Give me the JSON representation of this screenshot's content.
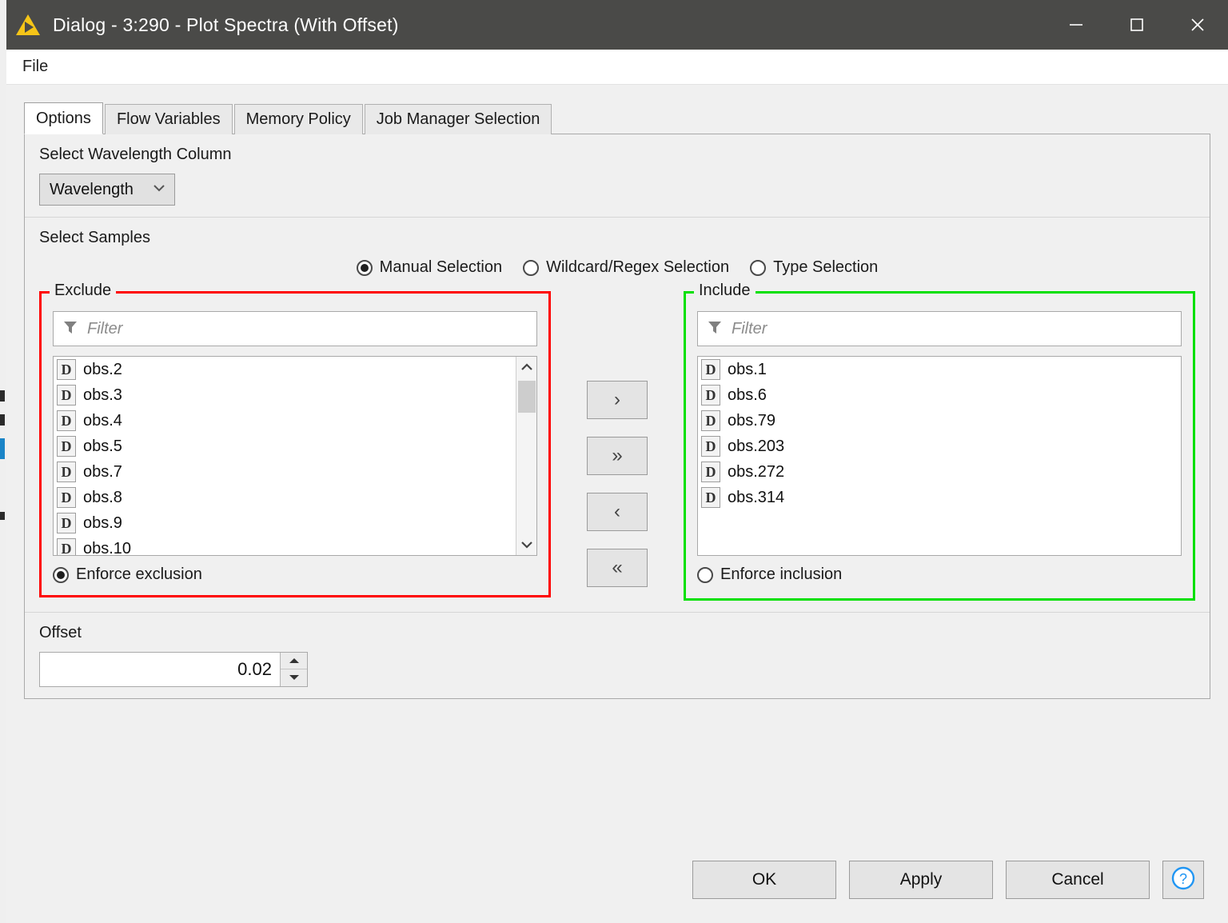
{
  "window": {
    "title": "Dialog - 3:290 - Plot Spectra (With Offset)",
    "app_icon": "knime-triangle-icon",
    "controls": {
      "minimize": "minimize-icon",
      "maximize": "maximize-icon",
      "close": "close-icon"
    }
  },
  "menubar": {
    "items": [
      "File"
    ]
  },
  "tabs": [
    {
      "label": "Options",
      "active": true
    },
    {
      "label": "Flow Variables",
      "active": false
    },
    {
      "label": "Memory Policy",
      "active": false
    },
    {
      "label": "Job Manager Selection",
      "active": false
    }
  ],
  "wavelength_section": {
    "label": "Select Wavelength Column",
    "dropdown": {
      "value": "Wavelength",
      "arrow": "chevron-down-icon"
    }
  },
  "samples_section": {
    "label": "Select Samples",
    "selection_modes": [
      {
        "label": "Manual Selection",
        "checked": true
      },
      {
        "label": "Wildcard/Regex Selection",
        "checked": false
      },
      {
        "label": "Type Selection",
        "checked": false
      }
    ],
    "exclude": {
      "legend": "Exclude",
      "border_color": "#ff0000",
      "filter_placeholder": "Filter",
      "filter_value": "",
      "filter_icon": "funnel-icon",
      "items": [
        {
          "type": "D",
          "label": "obs.2"
        },
        {
          "type": "D",
          "label": "obs.3"
        },
        {
          "type": "D",
          "label": "obs.4"
        },
        {
          "type": "D",
          "label": "obs.5"
        },
        {
          "type": "D",
          "label": "obs.7"
        },
        {
          "type": "D",
          "label": "obs.8"
        },
        {
          "type": "D",
          "label": "obs.9"
        },
        {
          "type": "D",
          "label": "obs.10"
        }
      ],
      "enforce": {
        "label": "Enforce exclusion",
        "checked": true
      }
    },
    "include": {
      "legend": "Include",
      "border_color": "#00e000",
      "filter_placeholder": "Filter",
      "filter_value": "",
      "filter_icon": "funnel-icon",
      "items": [
        {
          "type": "D",
          "label": "obs.1"
        },
        {
          "type": "D",
          "label": "obs.6"
        },
        {
          "type": "D",
          "label": "obs.79"
        },
        {
          "type": "D",
          "label": "obs.203"
        },
        {
          "type": "D",
          "label": "obs.272"
        },
        {
          "type": "D",
          "label": "obs.314"
        }
      ],
      "enforce": {
        "label": "Enforce inclusion",
        "checked": false
      }
    },
    "transfer_buttons": [
      {
        "label": "›",
        "name": "move-right-button"
      },
      {
        "label": "»",
        "name": "move-all-right-button"
      },
      {
        "label": "‹",
        "name": "move-left-button"
      },
      {
        "label": "«",
        "name": "move-all-left-button"
      }
    ]
  },
  "offset_section": {
    "label": "Offset",
    "value": "0.02"
  },
  "footer": {
    "ok": "OK",
    "apply": "Apply",
    "cancel": "Cancel",
    "help": "?"
  }
}
